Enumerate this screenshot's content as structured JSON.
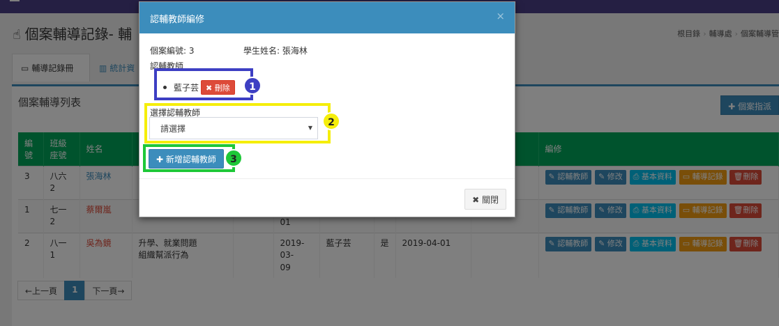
{
  "page": {
    "title": "個案輔導記錄- 輔",
    "breadcrumb": [
      "根目錄",
      "輔導處",
      "個案輔導管"
    ],
    "tabs": [
      "輔導記錄冊",
      "統計資"
    ],
    "panel_title": "個案輔導列表",
    "assign_button": "個案指派",
    "table": {
      "headers": [
        "編號",
        "班級座號",
        "姓名",
        "",
        "",
        "",
        "",
        "",
        "",
        "",
        "編修"
      ],
      "rows": [
        {
          "no": "3",
          "class": "八六 2",
          "name": "張海林",
          "name_color": "blue",
          "issue": "",
          "date": "",
          "teacher": "",
          "flag": "",
          "date2": ""
        },
        {
          "no": "1",
          "class": "七一 2",
          "name": "蔡爾嵐",
          "name_color": "red",
          "issue": "",
          "date": "01",
          "teacher": "",
          "flag": "",
          "date2": ""
        },
        {
          "no": "2",
          "class": "八一 1",
          "name": "吳為鏡",
          "name_color": "red",
          "issue": "升學、就業問題\n組織幫派行為",
          "date": "2019-03-\n09",
          "teacher": "藍子芸",
          "flag": "是",
          "date2": "2019-04-01"
        }
      ],
      "row_actions": [
        "認輔教師",
        "修改",
        "基本資料",
        "輔導記錄",
        "刪除"
      ]
    },
    "pager": {
      "prev": "←上一頁",
      "current": "1",
      "next": "下一頁→"
    }
  },
  "modal": {
    "title": "認輔教師編修",
    "close_icon": "×",
    "case_no_label": "個案編號: 3",
    "student_label": "學生姓名: 張海林",
    "teachers_label": "認輔教師",
    "teachers": [
      {
        "name": "藍子芸",
        "delete_label": "刪除"
      }
    ],
    "select_label": "選擇認輔教師",
    "select_value": "請選擇",
    "add_button": "新增認輔教師",
    "close_button": "關閉"
  },
  "annotations": [
    "1",
    "2",
    "3"
  ],
  "colors": {
    "primary": "#3c8dbc",
    "header_green": "#00a65a",
    "danger": "#dd4b39",
    "marker1": "#3d3fc3",
    "marker2": "#f5ee0b",
    "marker3": "#1ec838"
  }
}
